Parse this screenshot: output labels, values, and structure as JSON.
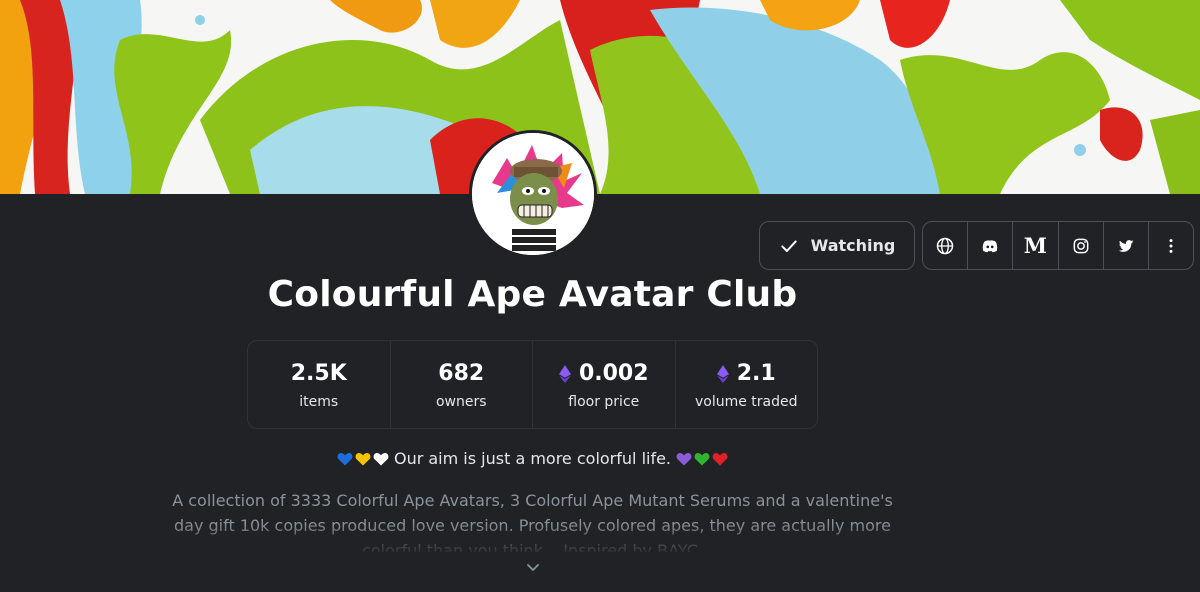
{
  "collection": {
    "title": "Colourful Ape Avatar Club",
    "tagline": "Our aim is just a more colorful life.",
    "tagline_hearts_before": [
      "#1e6fd9",
      "#f5c400",
      "#ffffff"
    ],
    "tagline_hearts_after": [
      "#8c5bd8",
      "#2fb52f",
      "#e0202a"
    ],
    "description": "A collection of 3333 Colorful Ape Avatars, 3 Colorful Ape Mutant Serums and a valentine's day gift 10k copies produced love version. Profusely colored apes, they are actually more colorful than you think... Inspired by BAYC."
  },
  "actions": {
    "watch_label": "Watching",
    "social_icons": [
      "globe-icon",
      "discord-icon",
      "medium-icon",
      "instagram-icon",
      "twitter-icon",
      "more-icon"
    ],
    "medium_glyph": "M"
  },
  "stats": [
    {
      "value": "2.5K",
      "label": "items",
      "eth": false
    },
    {
      "value": "682",
      "label": "owners",
      "eth": false
    },
    {
      "value": "0.002",
      "label": "floor price",
      "eth": true
    },
    {
      "value": "2.1",
      "label": "volume traded",
      "eth": true
    }
  ],
  "colors": {
    "background": "#202225",
    "border": "#4c505c",
    "eth": "#8a5cf5"
  }
}
